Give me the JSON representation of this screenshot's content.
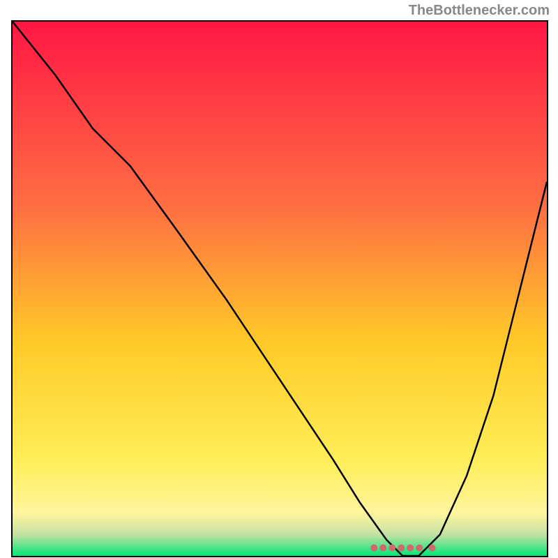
{
  "attribution": "TheBottlenecker.com",
  "chart_data": {
    "type": "line",
    "title": "",
    "xlabel": "",
    "ylabel": "",
    "xlim": [
      0,
      100
    ],
    "ylim": [
      0,
      100
    ],
    "gradient_stops": [
      {
        "offset": 0,
        "color": "#ff1744"
      },
      {
        "offset": 35,
        "color": "#ff7043"
      },
      {
        "offset": 60,
        "color": "#ffca28"
      },
      {
        "offset": 82,
        "color": "#ffee58"
      },
      {
        "offset": 92,
        "color": "#fff59d"
      },
      {
        "offset": 96,
        "color": "#c5e1a5"
      },
      {
        "offset": 100,
        "color": "#00e676"
      }
    ],
    "series": [
      {
        "name": "bottleneck-curve",
        "x": [
          0,
          8,
          15,
          22,
          30,
          40,
          50,
          60,
          65,
          70,
          73,
          76,
          80,
          85,
          90,
          95,
          100
        ],
        "values": [
          100,
          90,
          80,
          73,
          62,
          48,
          33,
          18,
          10,
          3,
          0,
          0,
          4,
          15,
          30,
          50,
          70
        ]
      }
    ],
    "marker": {
      "name": "optimal-range",
      "x_start": 67,
      "x_end": 78,
      "y": 1.5,
      "color": "#d0696a"
    }
  }
}
